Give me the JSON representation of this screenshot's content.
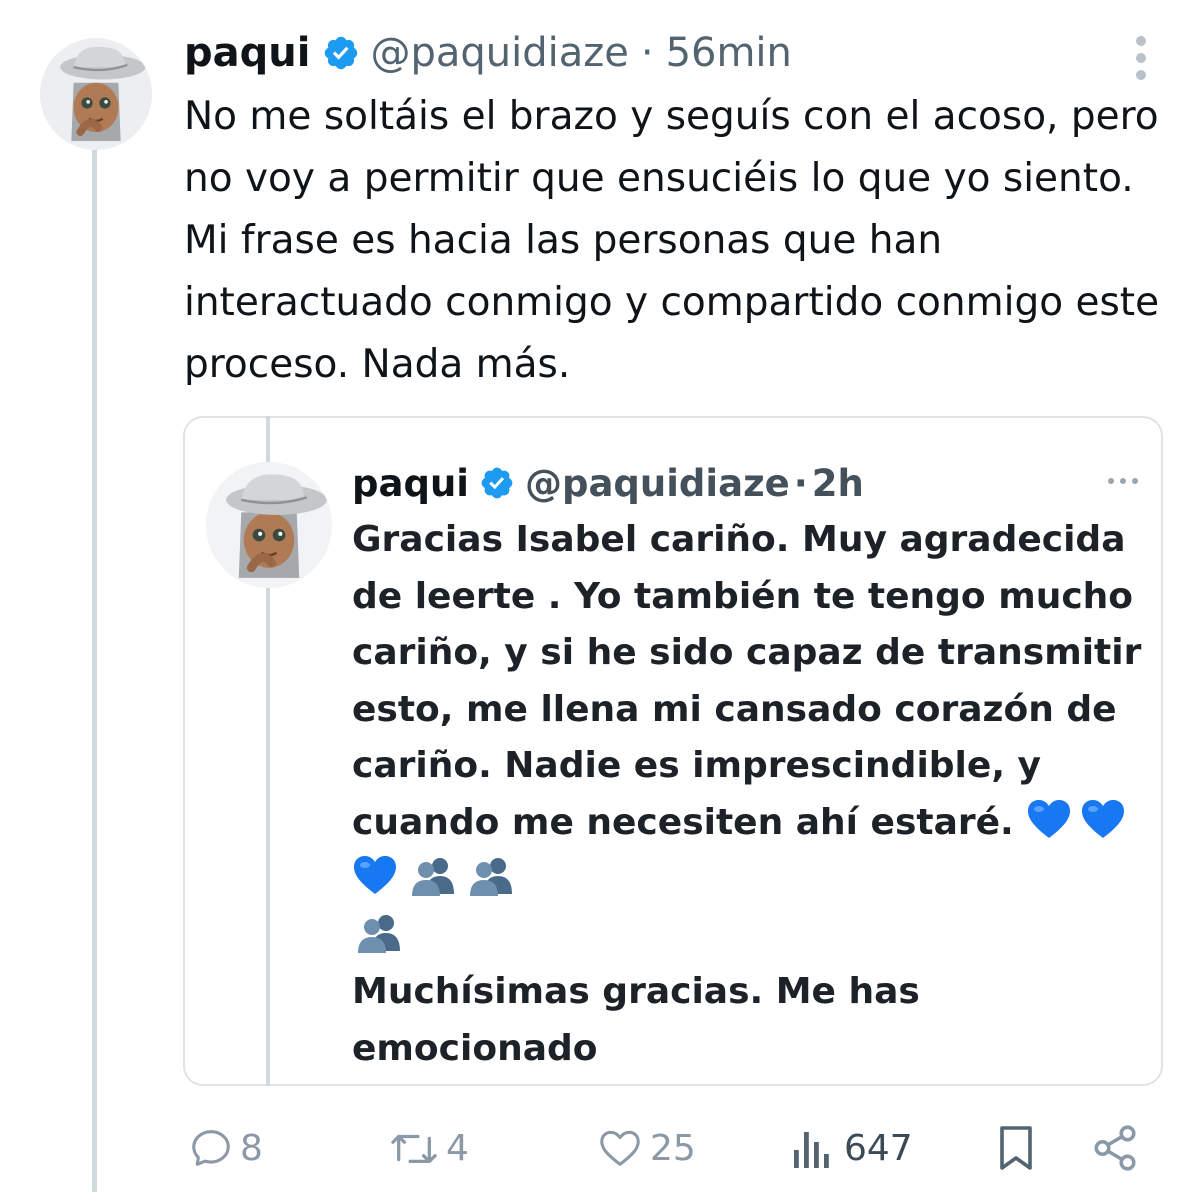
{
  "tweet": {
    "author_name": "paqui",
    "handle": "@paquidiaze",
    "separator": "·",
    "time": "56min",
    "text": "No me soltáis el brazo y seguís con el acoso, pero no voy a permitir que ensuciéis lo que yo siento. Mi frase es hacia las personas que han interactuado conmigo y compartido conmigo este proceso. Nada más."
  },
  "quoted": {
    "author_name": "paqui",
    "handle": "@paquidiaze",
    "separator": "·",
    "time": "2h",
    "text_main": "Gracias Isabel cariño. Muy agradecida de leerte . Yo también te tengo mucho cariño, y si he sido capaz de transmitir esto, me llena mi cansado corazón de cariño. Nadie es imprescindible, y cuando me necesiten ahí estaré.",
    "emojis": [
      "blue-heart",
      "blue-heart",
      "blue-heart",
      "busts-in-silhouette",
      "busts-in-silhouette",
      "busts-in-silhouette"
    ],
    "text_end": "Muchísimas gracias. Me has emocionado"
  },
  "actions": {
    "replies": "8",
    "reposts": "4",
    "likes": "25",
    "views": "647"
  },
  "icons": {
    "verified": "verified-badge-icon",
    "more": "more-vertical-icon",
    "reply": "reply-icon",
    "repost": "repost-icon",
    "like": "heart-icon",
    "views": "views-icon",
    "bookmark": "bookmark-icon",
    "share": "share-icon"
  },
  "colors": {
    "verified": "#1d9bf0",
    "secondary_text": "#536471",
    "icon_gray": "#8b98a5",
    "border": "#dfe3e6"
  }
}
